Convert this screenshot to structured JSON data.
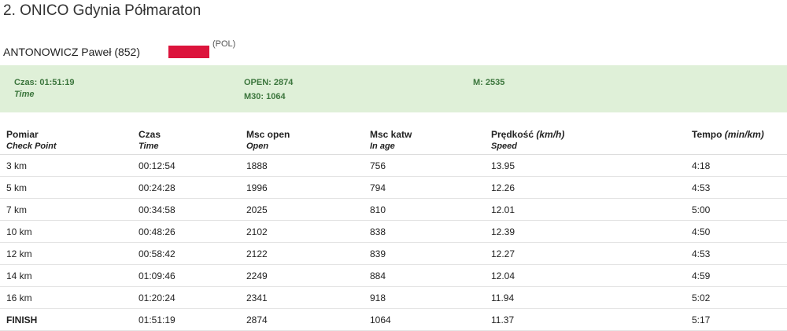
{
  "page": {
    "title": "2. ONICO Gdynia Półmaraton"
  },
  "athlete": {
    "name": "ANTONOWICZ Paweł (852)",
    "country": "(POL)",
    "flag_color": "#dc143c"
  },
  "summary": {
    "time_label": "Czas: 01:51:19",
    "time_sub": "Time",
    "open_label": "OPEN: 2874",
    "m30_label": "M30: 1064",
    "m_label": "M: 2535",
    "bg_color": "#dff0d8",
    "text_color": "#3c763d"
  },
  "table": {
    "headers": [
      {
        "pl": "Pomiar",
        "en": "Check Point",
        "unit": ""
      },
      {
        "pl": "Czas",
        "en": "Time",
        "unit": ""
      },
      {
        "pl": "Msc open",
        "en": "Open",
        "unit": ""
      },
      {
        "pl": "Msc katw",
        "en": "In age",
        "unit": ""
      },
      {
        "pl": "Prędkość ",
        "en": "Speed",
        "unit": "(km/h)"
      },
      {
        "pl": "Tempo ",
        "en": "",
        "unit": "(min/km)"
      }
    ],
    "rows": [
      [
        "3 km",
        "00:12:54",
        "1888",
        "756",
        "13.95",
        "4:18"
      ],
      [
        "5 km",
        "00:24:28",
        "1996",
        "794",
        "12.26",
        "4:53"
      ],
      [
        "7 km",
        "00:34:58",
        "2025",
        "810",
        "12.01",
        "5:00"
      ],
      [
        "10 km",
        "00:48:26",
        "2102",
        "838",
        "12.39",
        "4:50"
      ],
      [
        "12 km",
        "00:58:42",
        "2122",
        "839",
        "12.27",
        "4:53"
      ],
      [
        "14 km",
        "01:09:46",
        "2249",
        "884",
        "12.04",
        "4:59"
      ],
      [
        "16 km",
        "01:20:24",
        "2341",
        "918",
        "11.94",
        "5:02"
      ],
      [
        "FINISH",
        "01:51:19",
        "2874",
        "1064",
        "11.37",
        "5:17"
      ]
    ]
  }
}
